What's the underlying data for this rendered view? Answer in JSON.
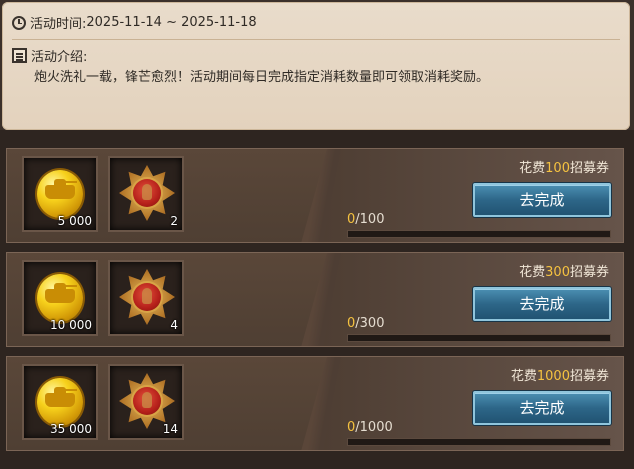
{
  "activity": {
    "time_label": "活动时间:",
    "time_value": "2025-11-14 ~ 2025-11-18",
    "intro_label": "活动介绍:",
    "intro_text": "炮火洗礼一载，锋芒愈烈！活动期间每日完成指定消耗数量即可领取消耗奖励。"
  },
  "icons": {
    "time": "clock-icon",
    "intro": "document-icon",
    "reward_1": "gold-coin-icon",
    "reward_2": "medal-icon"
  },
  "colors": {
    "accent_gold": "#f5c240",
    "button_blue": "#2d6688"
  },
  "tasks": [
    {
      "cost_prefix": "花费",
      "cost_amount": "100",
      "cost_suffix": "招募券",
      "button_label": "去完成",
      "progress_current": "0",
      "progress_total": "/100",
      "progress_fraction": 0,
      "rewards": [
        {
          "qty": "5 000"
        },
        {
          "qty": "2"
        }
      ]
    },
    {
      "cost_prefix": "花费",
      "cost_amount": "300",
      "cost_suffix": "招募券",
      "button_label": "去完成",
      "progress_current": "0",
      "progress_total": "/300",
      "progress_fraction": 0,
      "rewards": [
        {
          "qty": "10 000"
        },
        {
          "qty": "4"
        }
      ]
    },
    {
      "cost_prefix": "花费",
      "cost_amount": "1000",
      "cost_suffix": "招募券",
      "button_label": "去完成",
      "progress_current": "0",
      "progress_total": "/1000",
      "progress_fraction": 0,
      "rewards": [
        {
          "qty": "35 000"
        },
        {
          "qty": "14"
        }
      ]
    }
  ]
}
